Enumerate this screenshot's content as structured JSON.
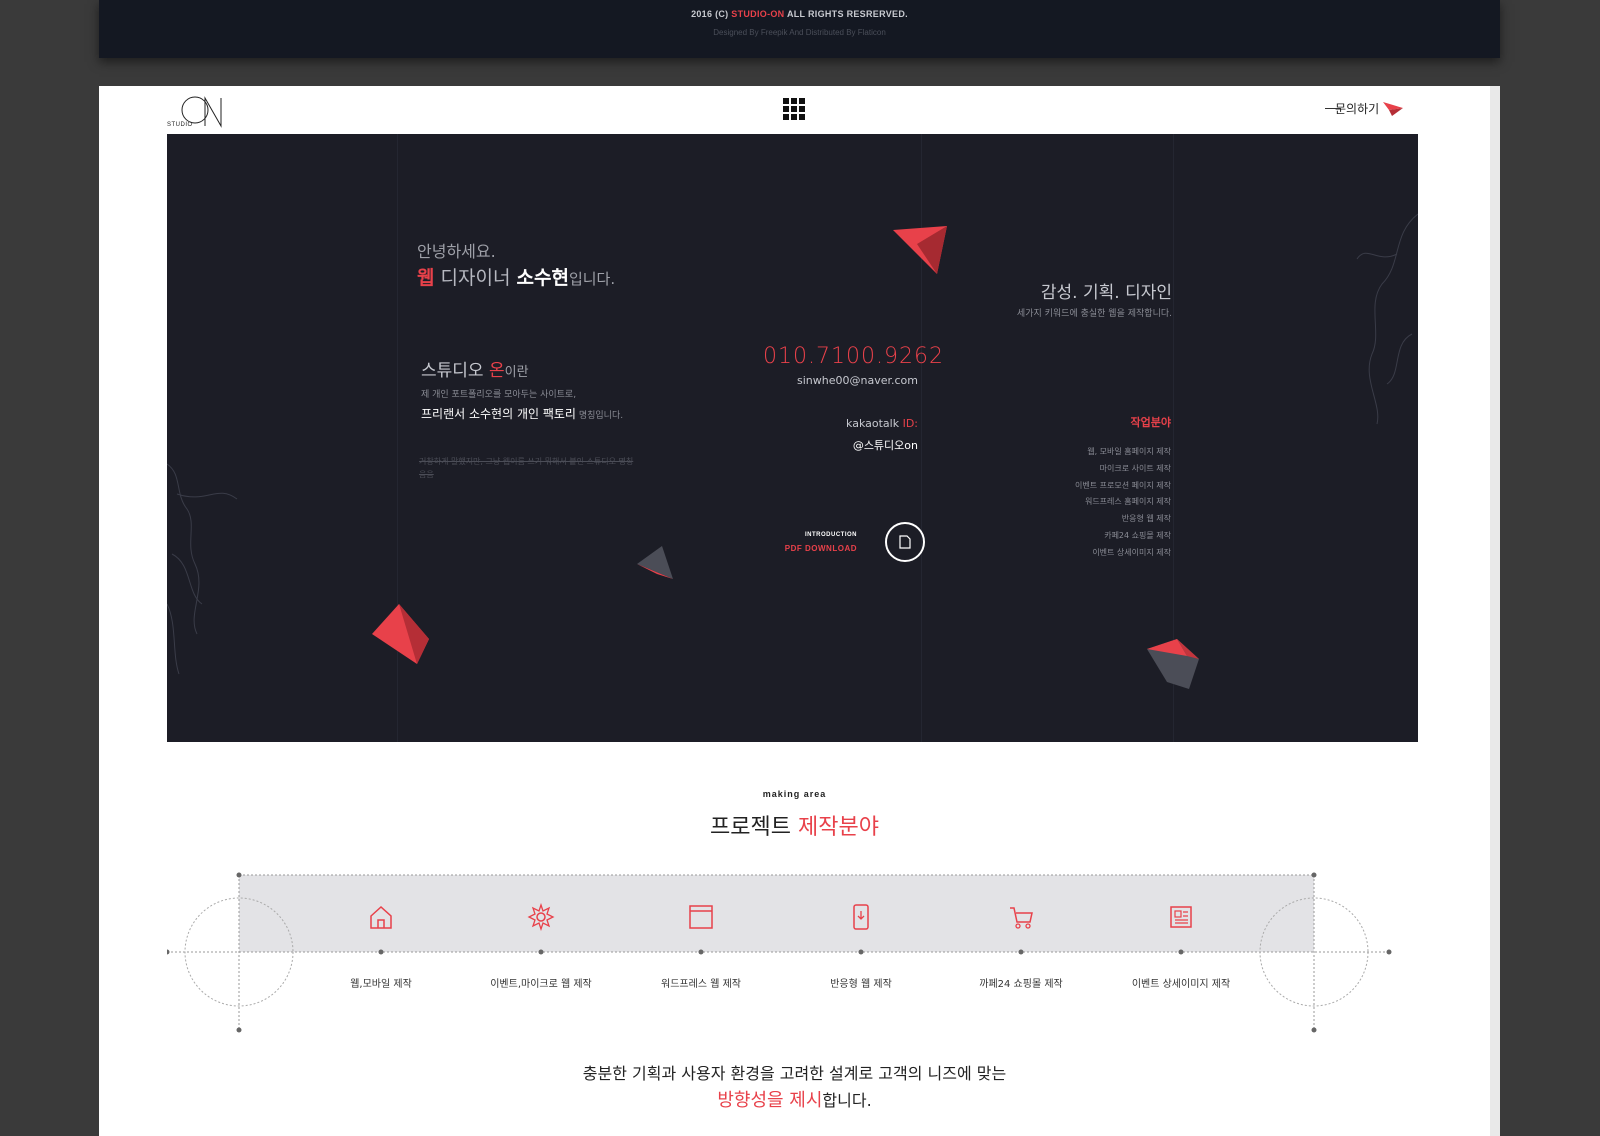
{
  "footer_strip": {
    "copyright_prefix": "2016 (C) ",
    "brand": "STUDIO-ON",
    "copyright_suffix": " ALL RIGHTS RESRERVED.",
    "credit": "Designed By Freepik And Distributed By Flaticon"
  },
  "header": {
    "logo_small": "STUDIO",
    "logo_letters": "ON",
    "menu_icon": "grid-menu-icon",
    "contact_label": "문의하기",
    "contact_icon": "paper-plane-icon"
  },
  "hero": {
    "greeting": "안녕하세요.",
    "headline_red": "웹",
    "headline_mid": " 디자이너 ",
    "headline_name": "소수현",
    "headline_end": "입니다.",
    "about_title_a": "스튜디오 ",
    "about_title_red": "온",
    "about_title_b": "이란",
    "about_line1": "제 개인 포트폴리오를 모아두는 사이트로,",
    "about_line2_strong": "프리랜서 소수현의 개인 팩토리",
    "about_line2_small": " 명칭입니다.",
    "strike_text": "거창하게 말했지만, 그냥 웹이름 쓰기 뭐해서 붙인 스튜디오 명칭 음음",
    "phone": "010.7100.9262",
    "email": "sinwhe00@naver.com",
    "kakao_label": "kakaotalk ",
    "kakao_label_red": "ID:",
    "kakao_id": "@스튜디오on",
    "intro_label": "INTRODUCTION",
    "pdf_label": "PDF DOWNLOAD",
    "pdf_icon": "document-icon",
    "keywords_title": "감성. 기획. 디자인",
    "keywords_sub": "세가지 키워드에 충실한 웹을 제작합니다.",
    "work_title": "작업분야",
    "work_list": [
      "웹, 모바일 홈페이지 제작",
      "마이크로 사이트 제작",
      "이벤트 프로모션 페이지 제작",
      "워드프레스 홈페이지 제작",
      "반응형 웹 제작",
      "카페24 쇼핑몰 제작",
      "이벤트 상세이미지 제작"
    ]
  },
  "section": {
    "subtitle": "making area",
    "title_a": "프로젝트 ",
    "title_red": "제작분야",
    "areas": [
      {
        "label": "웹,모바일 제작",
        "icon": "house-icon"
      },
      {
        "label": "이벤트,마이크로 웹 제작",
        "icon": "gear-icon"
      },
      {
        "label": "워드프레스 웹 제작",
        "icon": "browser-window-icon"
      },
      {
        "label": "반응형 웹 제작",
        "icon": "mobile-download-icon"
      },
      {
        "label": "까페24 쇼핑몰 제작",
        "icon": "shopping-cart-icon"
      },
      {
        "label": "이벤트 상세이미지 제작",
        "icon": "newspaper-icon"
      }
    ],
    "bottom_line1": "충분한 기획과 사용자 환경을 고려한 설계로 고객의 니즈에 맞는",
    "bottom_red": "방향성을 제시",
    "bottom_end": "합니다."
  },
  "colors": {
    "accent": "#e8414a",
    "hero_bg": "#1c1d26",
    "strip_bg": "#141822",
    "band_gray": "#e3e3e6"
  }
}
